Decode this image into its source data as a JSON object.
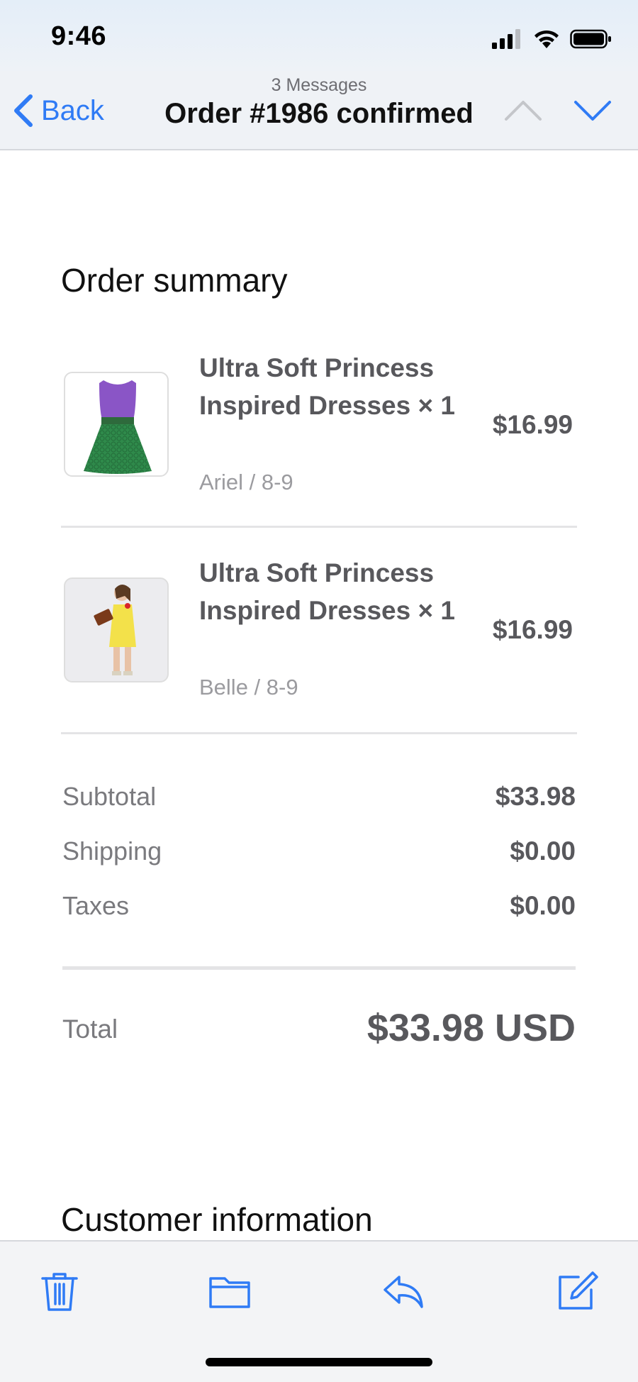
{
  "status_bar": {
    "time": "9:46"
  },
  "nav": {
    "back_label": "Back",
    "subtitle": "3 Messages",
    "title": "Order #1986 confirmed"
  },
  "order_summary": {
    "title": "Order summary",
    "items": [
      {
        "name": "Ultra Soft Princess Inspired Dresses × 1",
        "variant": "Ariel / 8-9",
        "price": "$16.99"
      },
      {
        "name": "Ultra Soft Princess Inspired Dresses × 1",
        "variant": "Belle / 8-9",
        "price": "$16.99"
      }
    ],
    "costs": [
      {
        "label": "Subtotal",
        "value": "$33.98"
      },
      {
        "label": "Shipping",
        "value": "$0.00"
      },
      {
        "label": "Taxes",
        "value": "$0.00"
      }
    ],
    "total_label": "Total",
    "total_value": "$33.98 USD"
  },
  "customer_information": {
    "title": "Customer information"
  },
  "colors": {
    "accent": "#2f7bf5",
    "text_muted": "#7a7a7e",
    "text_strong": "#58585c"
  },
  "toolbar": {
    "icons": [
      "trash-icon",
      "folder-icon",
      "reply-icon",
      "compose-icon"
    ]
  }
}
